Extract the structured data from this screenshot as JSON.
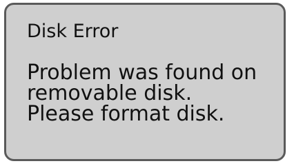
{
  "dialog": {
    "title": "Disk Error",
    "message_lines": [
      "Problem was found on",
      "removable disk.",
      "Please format disk."
    ]
  }
}
